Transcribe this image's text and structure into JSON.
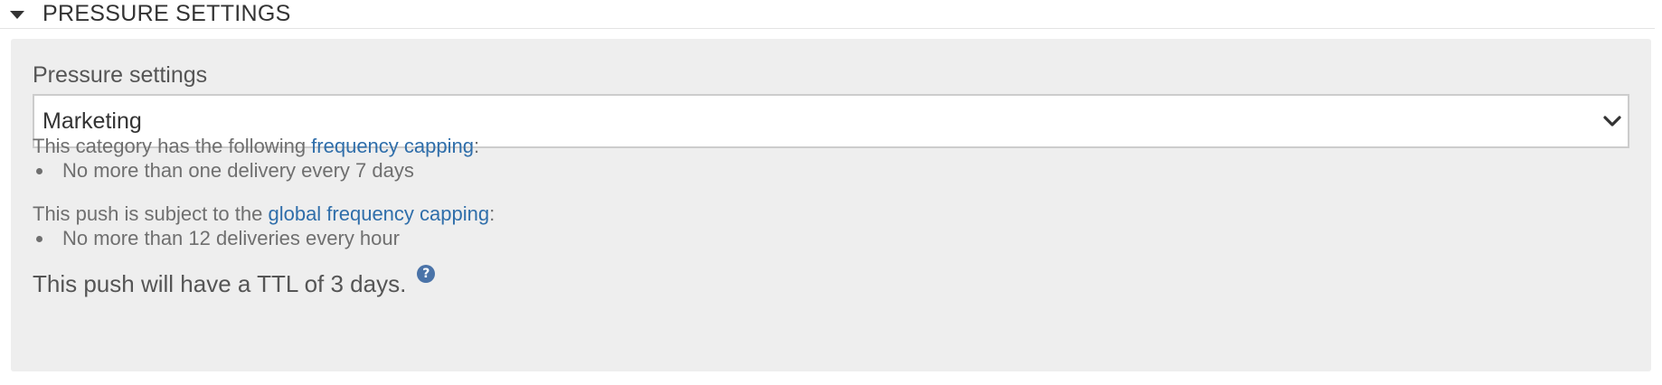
{
  "section": {
    "title": "PRESSURE SETTINGS"
  },
  "pressure": {
    "label": "Pressure settings",
    "selected": "Marketing",
    "category_text_prefix": "This category has the following ",
    "category_link": "frequency capping",
    "category_text_suffix": ":",
    "category_rules": [
      "No more than one delivery every 7 days"
    ],
    "global_text_prefix": "This push is subject to the ",
    "global_link": "global frequency capping",
    "global_text_suffix": ":",
    "global_rules": [
      "No more than 12 deliveries every hour"
    ],
    "ttl_text": "This push will have a TTL of 3 days.",
    "help_icon": "question-circle-icon",
    "help_glyph": "?"
  },
  "colors": {
    "link": "#2f6eaa",
    "panel_bg": "#eeeeee",
    "help_icon": "#4a73a8"
  }
}
